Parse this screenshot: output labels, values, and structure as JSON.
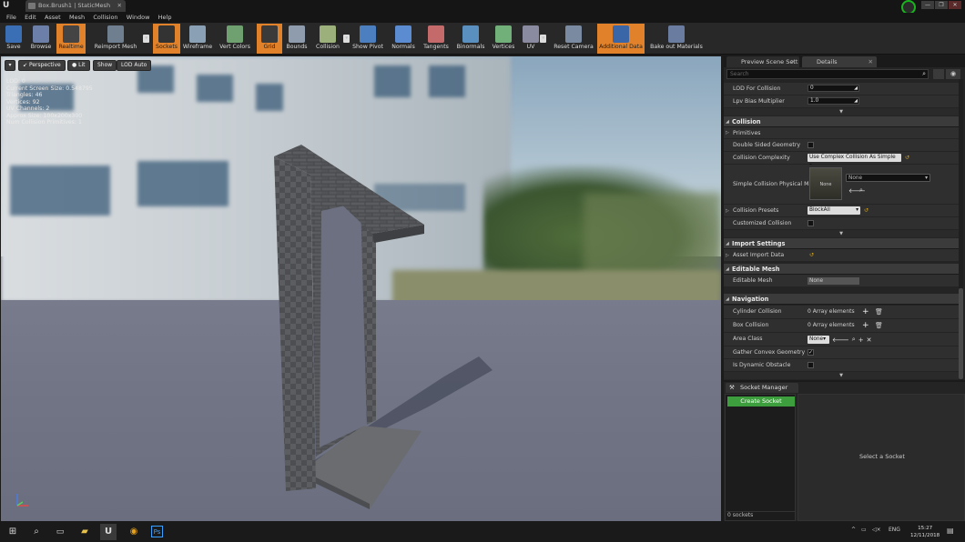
{
  "window": {
    "doc_tab": "Box.Brush1 | StaticMesh",
    "controls": [
      "—",
      "❐",
      "✕"
    ]
  },
  "menu": [
    "File",
    "Edit",
    "Asset",
    "Mesh",
    "Collision",
    "Window",
    "Help"
  ],
  "toolbar": [
    {
      "label": "Save",
      "active": false,
      "icon": "save-icon"
    },
    {
      "label": "Browse",
      "active": false,
      "icon": "browse-icon"
    },
    {
      "label": "Realtime",
      "active": true,
      "icon": "realtime-icon"
    },
    {
      "label": "Reimport Mesh",
      "active": false,
      "icon": "reimport-icon",
      "dropdown": true
    },
    {
      "label": "Sockets",
      "active": true,
      "icon": "sockets-icon"
    },
    {
      "label": "Wireframe",
      "active": false,
      "icon": "wireframe-icon"
    },
    {
      "label": "Vert Colors",
      "active": false,
      "icon": "vertcolors-icon"
    },
    {
      "label": "Grid",
      "active": true,
      "icon": "grid-icon"
    },
    {
      "label": "Bounds",
      "active": false,
      "icon": "bounds-icon"
    },
    {
      "label": "Collision",
      "active": false,
      "icon": "collision-icon",
      "dropdown": true
    },
    {
      "label": "Show Pivot",
      "active": false,
      "icon": "pivot-icon"
    },
    {
      "label": "Normals",
      "active": false,
      "icon": "normals-icon"
    },
    {
      "label": "Tangents",
      "active": false,
      "icon": "tangents-icon"
    },
    {
      "label": "Binormals",
      "active": false,
      "icon": "binormals-icon"
    },
    {
      "label": "Vertices",
      "active": false,
      "icon": "vertices-icon"
    },
    {
      "label": "UV",
      "active": false,
      "icon": "uv-icon",
      "dropdown": true
    },
    {
      "label": "Reset Camera",
      "active": false,
      "icon": "reset-camera-icon"
    },
    {
      "label": "Additional Data",
      "active": true,
      "icon": "additional-data-icon"
    },
    {
      "label": "Bake out Materials",
      "active": false,
      "icon": "bake-icon"
    }
  ],
  "viewport": {
    "buttons": [
      "Perspective",
      "Lit",
      "Show",
      "LOD Auto"
    ],
    "stats": [
      "LOD:  0",
      "Current Screen Size:  0.548795",
      "Triangles:  46",
      "Vertices:  92",
      "UV Channels:  2",
      "Approx Size: 100x200x300",
      "Num Collision Primitives:  1"
    ]
  },
  "panel": {
    "tabs": [
      "Preview Scene Sett",
      "Details"
    ],
    "search_placeholder": "Search",
    "lod_for_collision": {
      "label": "LOD For Collision",
      "value": "0"
    },
    "lpv_bias": {
      "label": "Lpv Bias Multiplier",
      "value": "1.0"
    },
    "collision": {
      "title": "Collision",
      "primitives": "Primitives",
      "double_sided": "Double Sided Geometry",
      "complexity_label": "Collision Complexity",
      "complexity_value": "Use Complex Collision As Simple",
      "physmat_label": "Simple Collision Physical Ma",
      "physmat_thumb": "None",
      "physmat_value": "None",
      "presets_label": "Collision Presets",
      "presets_value": "BlockAll",
      "customized": "Customized Collision"
    },
    "import_settings": {
      "title": "Import Settings",
      "asset_import": "Asset Import Data"
    },
    "editable_mesh": {
      "title": "Editable Mesh",
      "label": "Editable Mesh",
      "value": "None"
    },
    "navigation": {
      "title": "Navigation",
      "cylinder": {
        "label": "Cylinder Collision",
        "value": "0 Array elements"
      },
      "box": {
        "label": "Box Collision",
        "value": "0 Array elements"
      },
      "area_class": {
        "label": "Area Class",
        "value": "None"
      },
      "gather": "Gather Convex Geometry",
      "dynamic": "Is Dynamic Obstacle"
    }
  },
  "socket_manager": {
    "tab": "Socket Manager",
    "create": "Create Socket",
    "count": "0 sockets",
    "hint": "Select a Socket"
  },
  "taskbar": {
    "lang": "ENG",
    "time": "15:27",
    "date": "12/11/2018"
  }
}
